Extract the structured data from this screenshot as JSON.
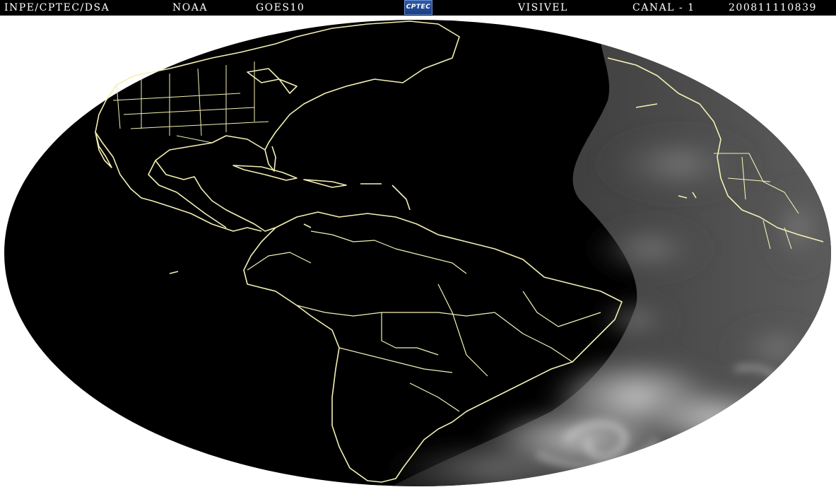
{
  "header": {
    "source": "INPE/CPTEC/DSA",
    "agency": "NOAA",
    "satellite": "GOES10",
    "logo_text": "CPTEC",
    "band": "VISIVEL",
    "channel": "CANAL - 1",
    "timestamp": "200811110839"
  },
  "colors": {
    "header_background": "#000000",
    "header_text": "#ffffff",
    "border_lines": "#f3f0b4",
    "night_side": "#000000",
    "day_side_clouds": "#8a8a8a",
    "outside_disk": "#ffffff"
  }
}
